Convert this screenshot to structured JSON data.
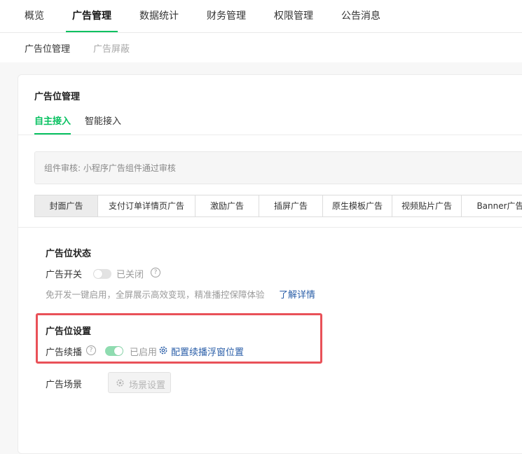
{
  "top_nav": [
    {
      "label": "概览",
      "active": false
    },
    {
      "label": "广告管理",
      "active": true
    },
    {
      "label": "数据统计",
      "active": false
    },
    {
      "label": "财务管理",
      "active": false
    },
    {
      "label": "权限管理",
      "active": false
    },
    {
      "label": "公告消息",
      "active": false
    }
  ],
  "sub_nav": [
    {
      "label": "广告位管理",
      "active": true
    },
    {
      "label": "广告屏蔽",
      "active": false
    }
  ],
  "card": {
    "title": "广告位管理",
    "tabs": [
      {
        "label": "自主接入",
        "active": true
      },
      {
        "label": "智能接入",
        "active": false
      }
    ],
    "notice": "组件审核: 小程序广告组件通过审核",
    "ad_types": [
      {
        "label": "封面广告",
        "active": true
      },
      {
        "label": "支付订单详情页广告",
        "active": false
      },
      {
        "label": "激励广告",
        "active": false
      },
      {
        "label": "插屏广告",
        "active": false
      },
      {
        "label": "原生模板广告",
        "active": false
      },
      {
        "label": "视频贴片广告",
        "active": false
      },
      {
        "label": "Banner广告",
        "active": false
      }
    ],
    "status_section": {
      "title": "广告位状态",
      "switch_label": "广告开关",
      "switch_state": "已关闭",
      "switch_on": false,
      "description": "免开发一键启用，全屏展示高效变现，精准播控保障体验",
      "learn_more": "了解详情"
    },
    "settings_section": {
      "title": "广告位设置",
      "continue_label": "广告续播",
      "continue_state": "已启用",
      "continue_on": true,
      "config_link": "配置续播浮窗位置"
    },
    "scene": {
      "label": "广告场景",
      "button": "场景设置"
    }
  },
  "colors": {
    "accent_green": "#07c160",
    "switch_on": "#8fdcb0",
    "link_blue": "#2a5ea8",
    "highlight_red": "#e95158"
  }
}
